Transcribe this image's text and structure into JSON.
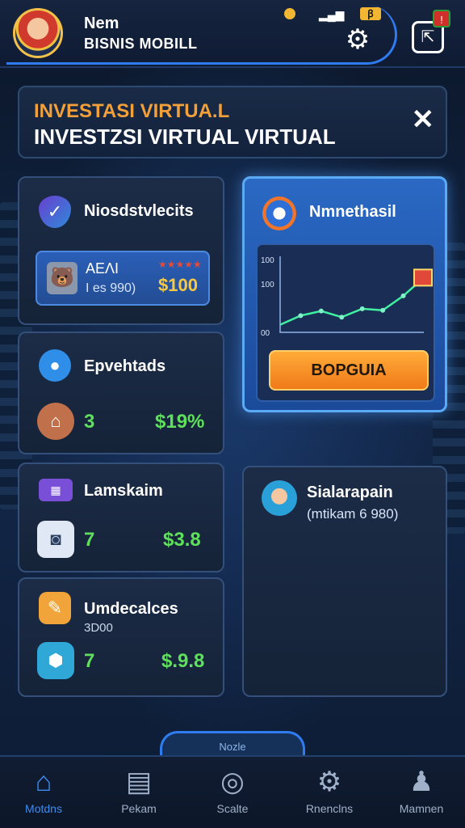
{
  "header": {
    "title_line1": "Nem",
    "title_line2": "BISNIS MOBILL",
    "status_time": "ꞵ ꞵ 5",
    "battery_label": "ꞵ"
  },
  "banner": {
    "line1": "INVESTASI VIRTUA.L",
    "line2": "INVESTZSI VIRTUAL VIRTUAL",
    "close_label": "✕"
  },
  "cards": {
    "left1": {
      "title": "Niosdstvlecits",
      "inner_name": "ΑΕΛΙ",
      "inner_sub": "I es 990)",
      "inner_value": "$100"
    },
    "left2": {
      "title": "Epvehtads",
      "count": "3",
      "value": "$19%"
    },
    "left3": {
      "title": "Lamskaim",
      "count": "7",
      "value": "$3.8"
    },
    "left4": {
      "title": "Umdecalces",
      "sub": "3D00",
      "count": "7",
      "value": "$.9.8"
    },
    "featured": {
      "title": "Nmnethasil",
      "y_ticks": [
        "100",
        "100",
        "00"
      ],
      "button_label": "BOPGUIA"
    },
    "right2": {
      "title": "Sialarapain",
      "sub": "(mtikam 6 980)"
    }
  },
  "chart_data": {
    "type": "line",
    "x": [
      1,
      2,
      3,
      4,
      5,
      6,
      7,
      8
    ],
    "values": [
      10,
      22,
      28,
      20,
      31,
      29,
      48,
      72
    ],
    "ylim": [
      0,
      100
    ],
    "title": "",
    "xlabel": "",
    "ylabel": ""
  },
  "tab_pill_label": "Nozle",
  "nav": [
    {
      "label": "Motdns",
      "icon": "home-icon"
    },
    {
      "label": "Pekam",
      "icon": "grid-icon"
    },
    {
      "label": "Scalte",
      "icon": "circle-icon"
    },
    {
      "label": "Rnenclns",
      "icon": "gear-icon"
    },
    {
      "label": "Mamnen",
      "icon": "person-icon"
    }
  ],
  "colors": {
    "accent": "#2f7bf0",
    "orange": "#f07a18",
    "green": "#5ee05c"
  }
}
